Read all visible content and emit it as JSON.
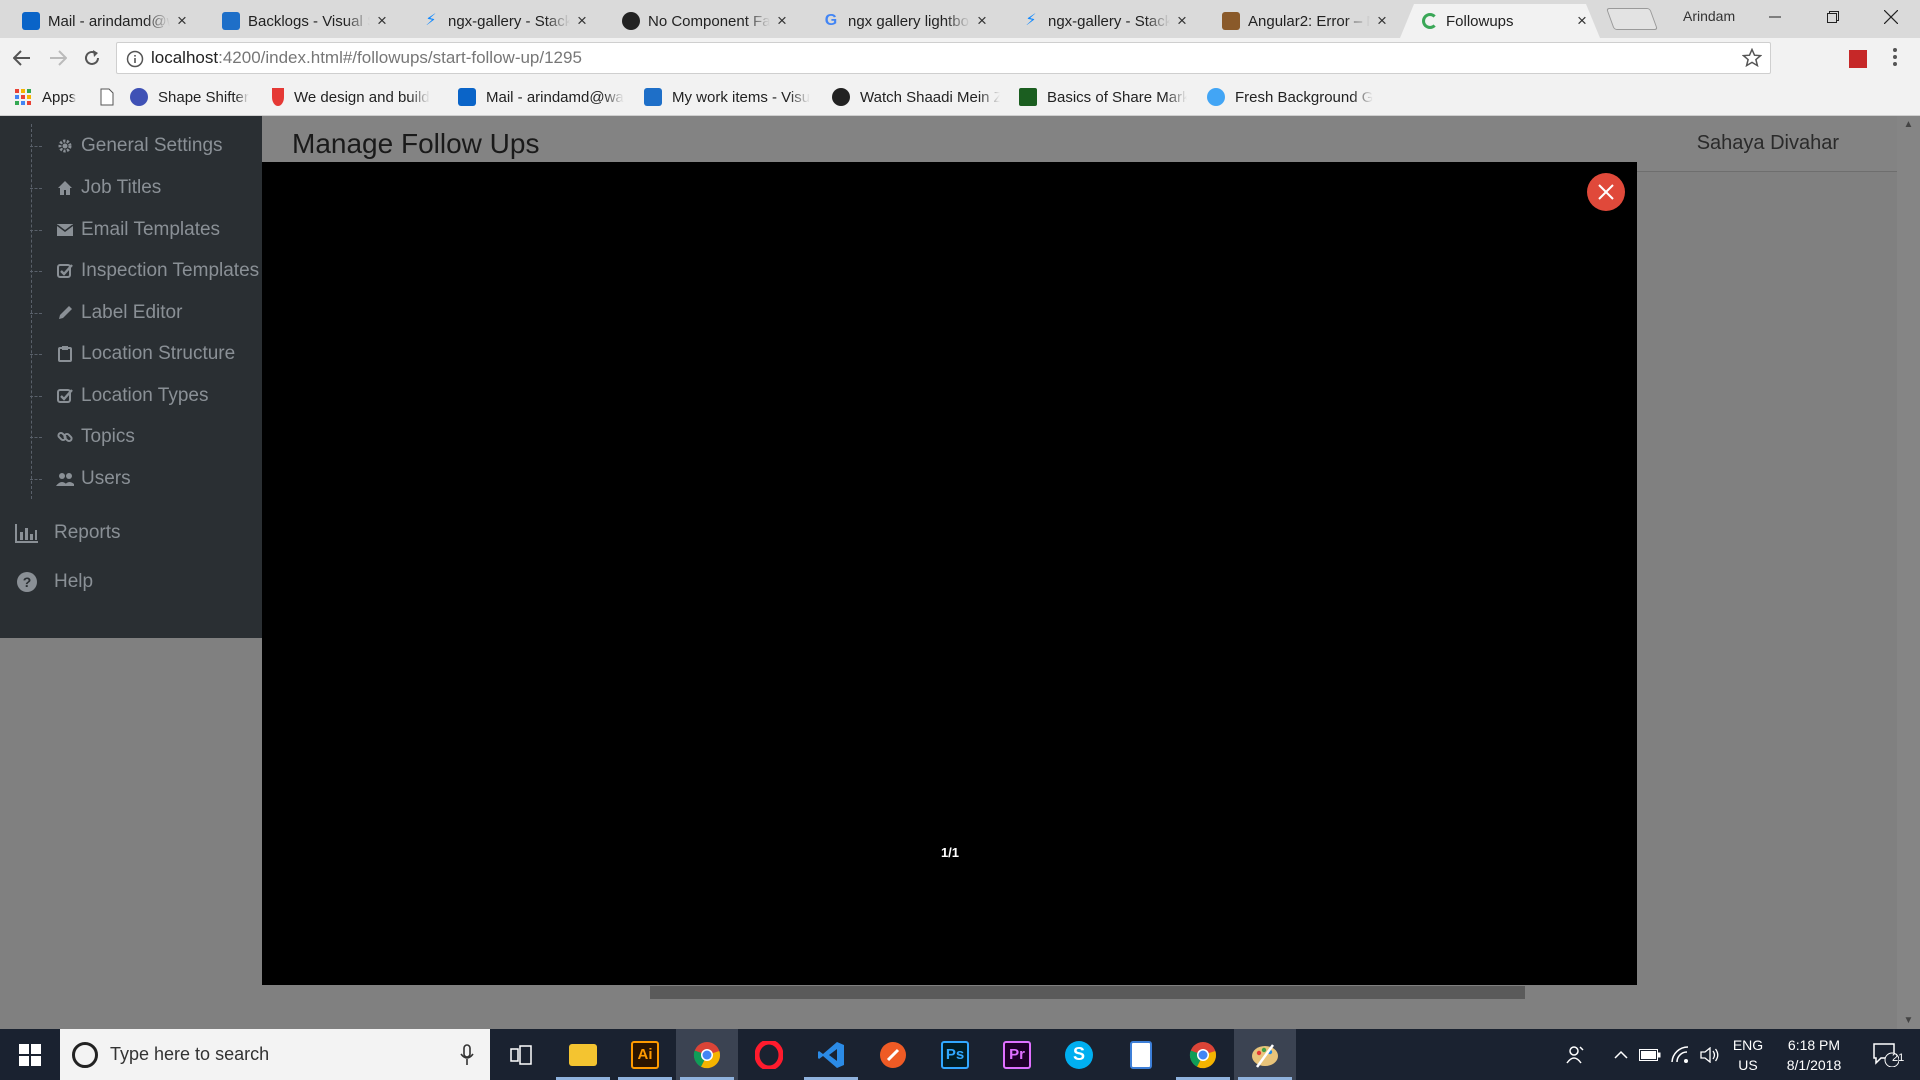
{
  "browser": {
    "tabs": [
      {
        "title": "Mail - arindamd@w",
        "icon": "outlook-icon",
        "color": "#0a64c8"
      },
      {
        "title": "Backlogs - Visual S",
        "icon": "vsts-icon",
        "color": "#1e6fc8"
      },
      {
        "title": "ngx-gallery - Stack",
        "icon": "stackblitz-icon",
        "color": "#1389fd"
      },
      {
        "title": "No Component Fa",
        "icon": "github-icon",
        "color": "#222222"
      },
      {
        "title": "ngx gallery lightbo",
        "icon": "google-icon",
        "color": "#4285f4"
      },
      {
        "title": "ngx-gallery - Stack",
        "icon": "stackblitz-icon",
        "color": "#1389fd"
      },
      {
        "title": "Angular2: Error – N",
        "icon": "site-avatar-icon",
        "color": "#8a5a2a"
      },
      {
        "title": "Followups",
        "icon": "loading-icon",
        "color": "#3aa757",
        "active": true
      }
    ],
    "profile_name": "Arindam",
    "url_host": "localhost",
    "url_path": ":4200/index.html#/followups/start-follow-up/1295",
    "bookmarks": [
      {
        "label": "Apps",
        "icon": "apps-grid-icon",
        "color": "#e94235"
      },
      {
        "label": "",
        "icon": "page-icon",
        "color": "#ffffff"
      },
      {
        "label": "Shape Shifter",
        "icon": "shape-shifter-icon",
        "color": "#3f51b5"
      },
      {
        "label": "We design and build",
        "icon": "flask-icon",
        "color": "#e53935"
      },
      {
        "label": "Mail - arindamd@wa",
        "icon": "outlook-icon",
        "color": "#0a64c8"
      },
      {
        "label": "My work items - Visu",
        "icon": "vsts-icon",
        "color": "#1e6fc8"
      },
      {
        "label": "Watch Shaadi Mein Z",
        "icon": "film-reel-icon",
        "color": "#222222"
      },
      {
        "label": "Basics of Share Mark",
        "icon": "s-logo-icon",
        "color": "#1b5e20"
      },
      {
        "label": "Fresh Background G",
        "icon": "globe-icon",
        "color": "#42a5f5"
      }
    ]
  },
  "sidebar": {
    "items": [
      {
        "label": "General Settings",
        "icon": "gear-icon"
      },
      {
        "label": "Job Titles",
        "icon": "home-icon"
      },
      {
        "label": "Email Templates",
        "icon": "envelope-icon"
      },
      {
        "label": "Inspection Templates",
        "icon": "checkbox-icon"
      },
      {
        "label": "Label Editor",
        "icon": "pencil-icon"
      },
      {
        "label": "Location Structure",
        "icon": "clipboard-icon"
      },
      {
        "label": "Location Types",
        "icon": "checkbox-icon"
      },
      {
        "label": "Topics",
        "icon": "link-icon"
      },
      {
        "label": "Users",
        "icon": "users-icon"
      }
    ],
    "reports": "Reports",
    "help": "Help"
  },
  "page": {
    "title": "Manage Follow Ups",
    "user_name": "Sahaya Divahar"
  },
  "lightbox": {
    "counter": "1/1",
    "close_color": "#e0493a"
  },
  "taskbar": {
    "search_placeholder": "Type here to search",
    "apps": [
      {
        "name": "file-explorer-icon",
        "label": "",
        "color": "#f4c430"
      },
      {
        "name": "illustrator-icon",
        "label": "Ai",
        "color": "#ff9a00"
      },
      {
        "name": "chrome-icon",
        "label": "",
        "color": "#4285f4"
      },
      {
        "name": "opera-icon",
        "label": "",
        "color": "#ff1b2d"
      },
      {
        "name": "vscode-icon",
        "label": "",
        "color": "#2b8be6"
      },
      {
        "name": "postman-icon",
        "label": "",
        "color": "#ef5b25"
      },
      {
        "name": "photoshop-icon",
        "label": "Ps",
        "color": "#31a8ff"
      },
      {
        "name": "premiere-icon",
        "label": "Pr",
        "color": "#e070ff"
      },
      {
        "name": "skype-icon",
        "label": "S",
        "color": "#00aff0"
      },
      {
        "name": "paint-file-icon",
        "label": "",
        "color": "#3d7fd8"
      },
      {
        "name": "chrome-icon",
        "label": "",
        "color": "#4285f4"
      },
      {
        "name": "paint-icon",
        "label": "",
        "color": "#e8c47a"
      }
    ],
    "lang_top": "ENG",
    "lang_bottom": "US",
    "time": "6:18 PM",
    "date": "8/1/2018",
    "notification_count": "21"
  }
}
